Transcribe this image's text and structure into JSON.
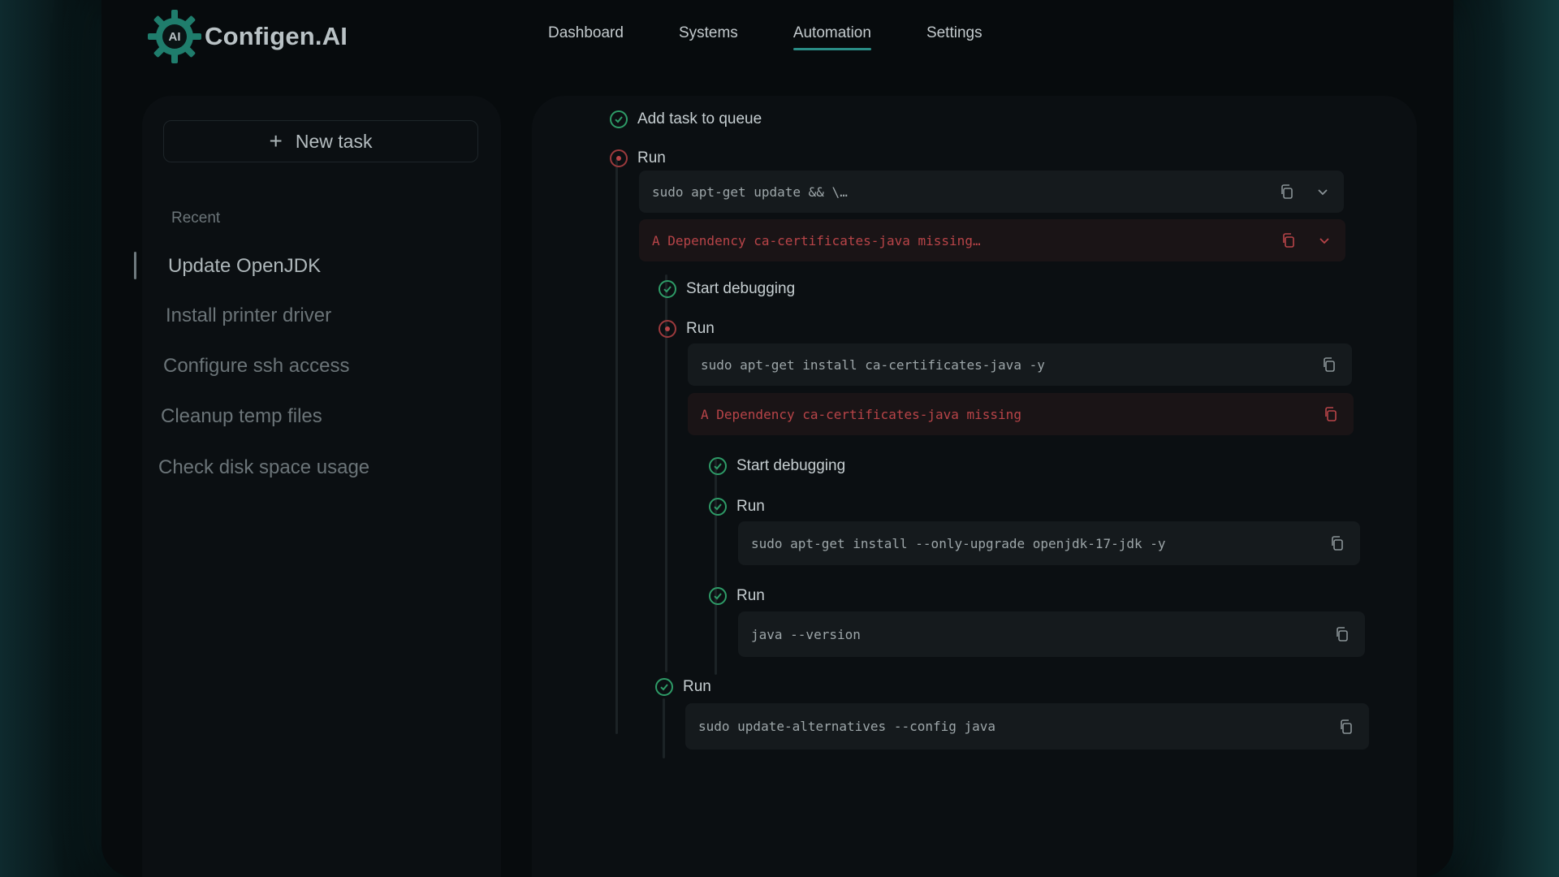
{
  "app": {
    "title": "Configen.AI",
    "logo_badge": "AI"
  },
  "nav": [
    {
      "label": "Dashboard",
      "active": false
    },
    {
      "label": "Systems",
      "active": false
    },
    {
      "label": "Automation",
      "active": true
    },
    {
      "label": "Settings",
      "active": false
    }
  ],
  "sidebar": {
    "new_task_label": "New task",
    "recent_label": "Recent",
    "items": [
      {
        "label": "Update OpenJDK"
      },
      {
        "label": "Install printer driver"
      },
      {
        "label": "Configure ssh access"
      },
      {
        "label": "Cleanup temp files"
      },
      {
        "label": "Check disk space usage"
      }
    ]
  },
  "workflow": {
    "s1": {
      "label": "Add task to queue",
      "status": "success"
    },
    "s2": {
      "label": "Run",
      "status": "error",
      "command": "sudo apt-get update && \\…",
      "error": "A Dependency ca-certificates-java missing…"
    },
    "s3": {
      "label": "Start debugging",
      "status": "success"
    },
    "s4": {
      "label": "Run",
      "status": "error",
      "command": "sudo apt-get install ca-certificates-java -y",
      "error": "A Dependency ca-certificates-java missing"
    },
    "s5": {
      "label": "Start debugging",
      "status": "success"
    },
    "s6": {
      "label": "Run",
      "status": "success",
      "command": "sudo apt-get install --only-upgrade openjdk-17-jdk -y"
    },
    "s7": {
      "label": "Run",
      "status": "success",
      "command": "java --version"
    },
    "s8": {
      "label": "Run",
      "status": "success",
      "command": "sudo update-alternatives --config java"
    }
  },
  "colors": {
    "accent": "#2a8d86",
    "success": "#2e9b67",
    "error": "#b84448"
  },
  "icons": {
    "success": "check-circle-icon",
    "error": "x-circle-icon",
    "copy": "copy-icon",
    "expand": "chevron-down-icon",
    "add": "plus-icon"
  }
}
